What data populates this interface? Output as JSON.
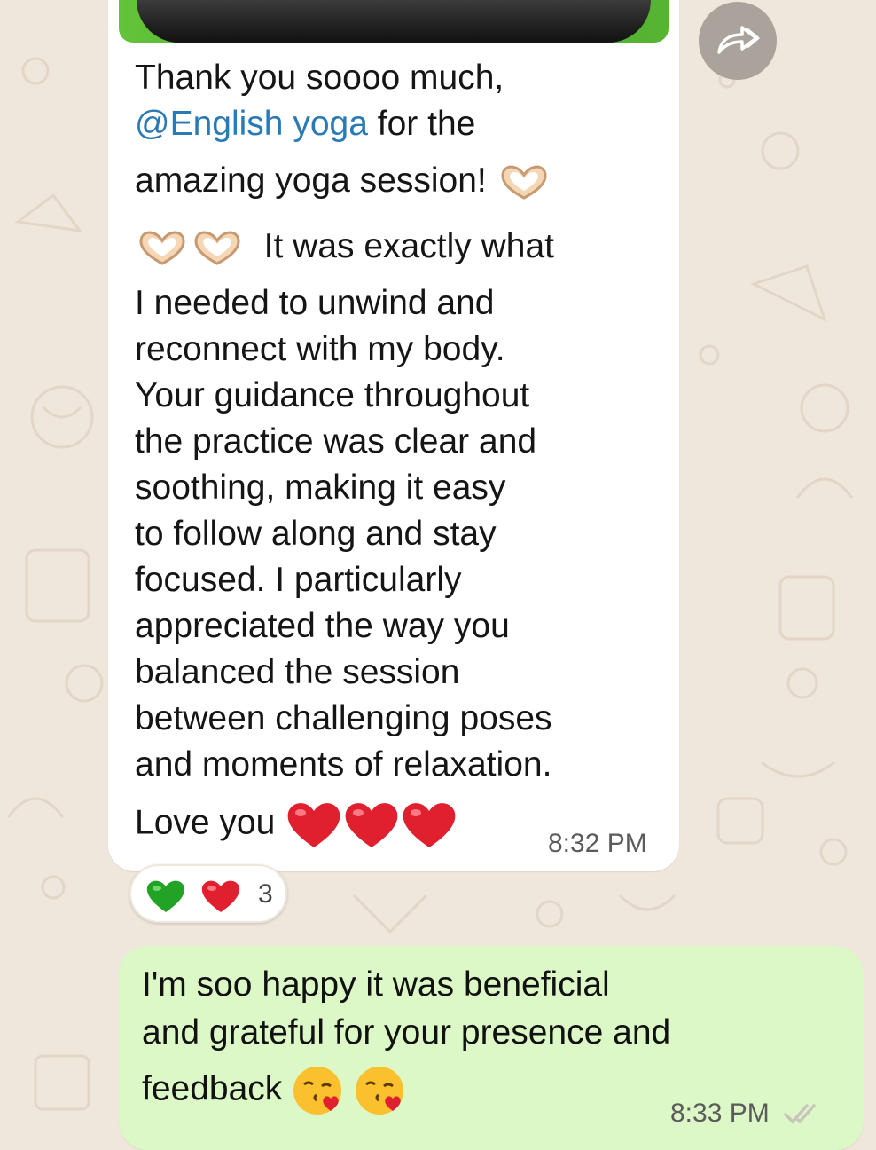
{
  "incoming_message": {
    "lines": [
      "Thank you soooo much,",
      "for the",
      "amazing yoga session!",
      "It was exactly what",
      "I needed to unwind and",
      "reconnect with my body.",
      "Your guidance throughout",
      "the practice was clear and",
      "soothing, making it easy",
      "to follow along and stay",
      "focused. I particularly",
      "appreciated the way you",
      "balanced the session",
      "between challenging poses",
      "and moments of relaxation.",
      "Love you"
    ],
    "mention": "@English yoga",
    "time": "8:32 PM"
  },
  "reactions": {
    "emojis": [
      "green-heart",
      "red-heart"
    ],
    "count": "3"
  },
  "outgoing_message": {
    "lines": [
      "I'm soo happy it was beneficial",
      "and grateful for your presence and",
      "feedback"
    ],
    "time": "8:33 PM",
    "status": "read-double-check"
  },
  "colors": {
    "wallpaper": "#efe7dc",
    "incoming_bubble": "#ffffff",
    "outgoing_bubble": "#dcf8c6",
    "mention": "#2a7ab5",
    "forward_button": "#a9a39b"
  }
}
